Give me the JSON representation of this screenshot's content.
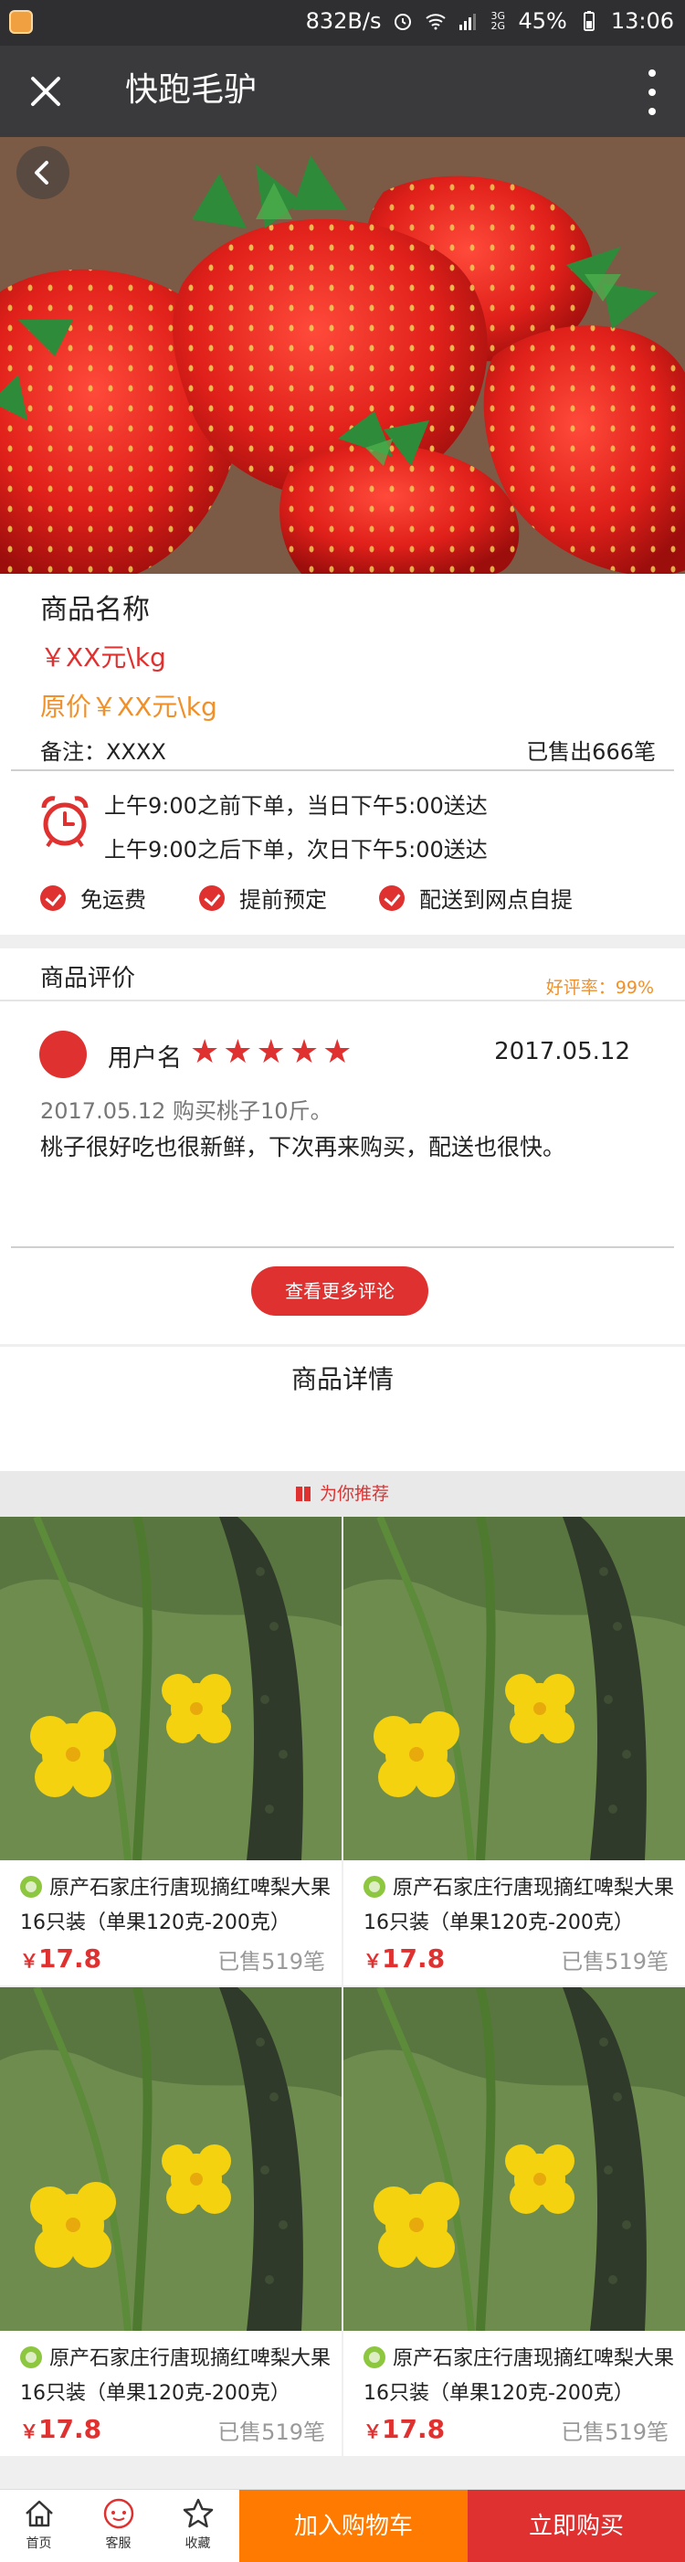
{
  "status_bar": {
    "speed": "832B/s",
    "network": "3G 2G",
    "battery": "45%",
    "time": "13:06"
  },
  "header": {
    "title": "快跑毛驴"
  },
  "product": {
    "name": "商品名称",
    "price": "￥XX元\\kg",
    "original_price": "原价￥XX元\\kg",
    "note": "备注：XXXX",
    "sold": "已售出666笔",
    "delivery_rules": [
      "上午9:00之前下单，当日下午5:00送达",
      "上午9:00之后下单，次日下午5:00送达"
    ],
    "features": [
      "免运费",
      "提前预定",
      "配送到网点自提"
    ]
  },
  "review": {
    "heading": "商品评价",
    "good_rate": "好评率：99%",
    "username": "用户名",
    "stars": 5,
    "date": "2017.05.12",
    "meta": "2017.05.12 购买桃子10斤。",
    "text": "桃子很好吃也很新鲜，下次再来购买，配送也很快。",
    "more_button": "查看更多评论"
  },
  "details": {
    "heading": "商品详情"
  },
  "recommend": {
    "heading": "为你推荐",
    "items": [
      {
        "name": "原产石家庄行唐现摘红啤梨大果16只装（单果120克-200克）",
        "currency": "￥",
        "price": "17.8",
        "sold": "已售519笔"
      },
      {
        "name": "原产石家庄行唐现摘红啤梨大果16只装（单果120克-200克）",
        "currency": "￥",
        "price": "17.8",
        "sold": "已售519笔"
      },
      {
        "name": "原产石家庄行唐现摘红啤梨大果16只装（单果120克-200克）",
        "currency": "￥",
        "price": "17.8",
        "sold": "已售519笔"
      },
      {
        "name": "原产石家庄行唐现摘红啤梨大果16只装（单果120克-200克）",
        "currency": "￥",
        "price": "17.8",
        "sold": "已售519笔"
      }
    ]
  },
  "bottom_bar": {
    "home": "首页",
    "service": "客服",
    "favorite": "收藏",
    "add_to_cart": "加入购物车",
    "buy_now": "立即购买"
  },
  "colors": {
    "accent_red": "#e03131",
    "accent_orange": "#ff7a00",
    "header_bg": "#3a3a3c"
  }
}
